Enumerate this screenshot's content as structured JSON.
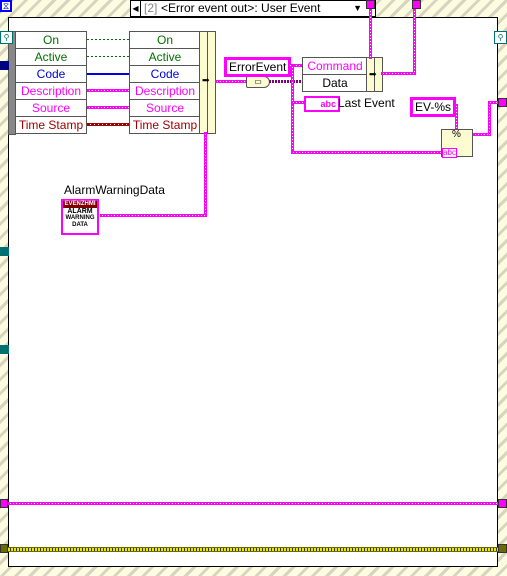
{
  "event_structure": {
    "case_index": "[2]",
    "case_label": "<Error event out>: User Event",
    "border_color": "#fdfbe0"
  },
  "input_cluster": {
    "fields": [
      {
        "label": "On",
        "color": "#007000"
      },
      {
        "label": "Active",
        "color": "#007000"
      },
      {
        "label": "Code",
        "color": "#0000e0"
      },
      {
        "label": "Description",
        "color": "#ff00ff"
      },
      {
        "label": "Source",
        "color": "#ff00ff"
      },
      {
        "label": "Time Stamp",
        "color": "#a00000"
      }
    ]
  },
  "output_cluster": {
    "fields": [
      {
        "label": "On",
        "color": "#007000"
      },
      {
        "label": "Active",
        "color": "#007000"
      },
      {
        "label": "Code",
        "color": "#0000e0"
      },
      {
        "label": "Description",
        "color": "#ff00ff"
      },
      {
        "label": "Source",
        "color": "#ff00ff"
      },
      {
        "label": "Time Stamp",
        "color": "#a00000"
      }
    ]
  },
  "message_cluster": {
    "fields": [
      {
        "label": "Command",
        "color": "#ff00ff"
      },
      {
        "label": "Data",
        "color": "#000000"
      }
    ]
  },
  "constants": {
    "error_event": "ErrorEvent",
    "format_string": "EV-%s"
  },
  "indicators": {
    "last_event": "Last Event",
    "last_event_icon": "abc"
  },
  "subvi": {
    "label": "AlarmWarningData",
    "icon_header": "EVENZHMI",
    "icon_lines": [
      "ALARM",
      "WARNING",
      "DATA"
    ]
  },
  "format_node": {
    "icon_text": "abc",
    "glyph": "%"
  },
  "colors": {
    "string_wire": "#ff00ff",
    "boolean_wire": "#007000",
    "numeric_wire": "#0000e0",
    "timestamp_wire": "#a00000",
    "refnum_tunnel": "#007070",
    "olive_wire": "#6b6b00"
  }
}
